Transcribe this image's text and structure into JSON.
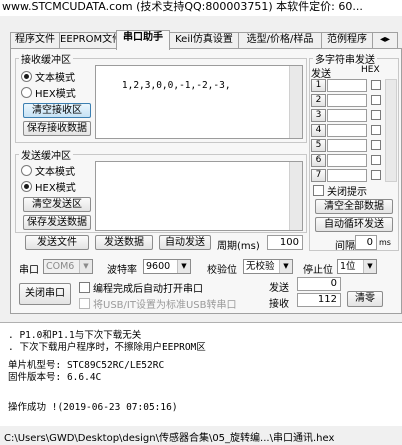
{
  "title": "www.STCMCUDATA.com (技术支持QQ:800003751) 本软件定价: 60...",
  "tabs": [
    "程序文件",
    "EEPROM文件",
    "串口助手",
    "Keil仿真设置",
    "选型/价格/样品",
    "范例程序"
  ],
  "receive": {
    "group_label": "接收缓冲区",
    "text_mode": "文本模式",
    "hex_mode": "HEX模式",
    "selected_mode": "文本模式",
    "clear_btn": "清空接收区",
    "save_btn": "保存接收数据",
    "content": "1,2,3,0,0,-1,-2,-3,"
  },
  "send": {
    "group_label": "发送缓冲区",
    "text_mode": "文本模式",
    "hex_mode": "HEX模式",
    "selected_mode": "HEX模式",
    "clear_btn": "清空发送区",
    "save_btn": "保存发送数据",
    "content": ""
  },
  "actions": {
    "send_file": "发送文件",
    "send_data": "发送数据",
    "auto_send": "自动发送",
    "period_label": "周期(ms)",
    "period_value": "100"
  },
  "multi": {
    "group_label": "多字符串发送",
    "send_header": "发送",
    "hex_header": "HEX",
    "rows": [
      "1",
      "2",
      "3",
      "4",
      "5",
      "6",
      "7"
    ],
    "close_prompt": "关闭提示",
    "clear_all": "清空全部数据",
    "auto_loop": "自动循环发送",
    "interval_label": "间隔",
    "interval_value": "0",
    "interval_unit": "ms"
  },
  "serial": {
    "port_label": "串口",
    "port_value": "COM6",
    "baud_label": "波特率",
    "baud_value": "9600",
    "parity_label": "校验位",
    "parity_value": "无校验",
    "stop_label": "停止位",
    "stop_value": "1位",
    "close_port": "关闭串口",
    "auto_open": "编程完成后自动打开串口",
    "usb_cdc": "将USB/IT设置为标准USB转串口",
    "sent_label": "发送",
    "sent_value": "0",
    "recv_label": "接收",
    "recv_value": "112",
    "clear_counts": "清零"
  },
  "log": [
    ". P1.0和P1.1与下次下载无关",
    ". 下次下载用户程序时，不擦除用户EEPROM区",
    "单片机型号: STC89C52RC/LE52RC",
    "固件版本号: 6.6.4C",
    "操作成功 !(2019-06-23 07:05:16)"
  ],
  "status_path": "C:\\Users\\GWD\\Desktop\\design\\传感器合集\\05_旋转编...\\串口通讯.hex"
}
